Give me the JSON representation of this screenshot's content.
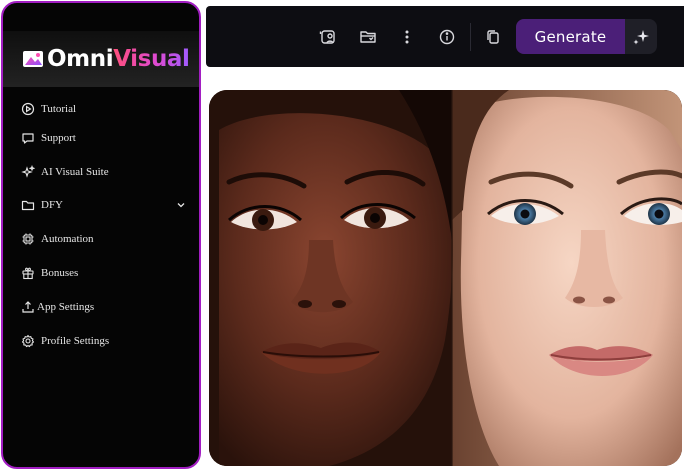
{
  "brand": {
    "name_part1": "Omni",
    "name_part2": "Visual",
    "icon": "omnivisual-logo-icon"
  },
  "sidebar": {
    "items": [
      {
        "label": "Tutorial",
        "icon": "play-circle-icon"
      },
      {
        "label": "Support",
        "icon": "chat-bubble-icon"
      },
      {
        "label": "AI Visual Suite",
        "icon": "sparkles-icon"
      },
      {
        "label": "DFY",
        "icon": "folder-icon",
        "expandable": true
      },
      {
        "label": "Automation",
        "icon": "chip-icon"
      },
      {
        "label": "Bonuses",
        "icon": "gift-icon"
      },
      {
        "label": "App Settings",
        "icon": "upload-icon"
      },
      {
        "label": "Profile Settings",
        "icon": "gear-icon"
      }
    ]
  },
  "toolbar": {
    "icons": [
      "image-user-icon",
      "folder-save-icon",
      "more-vertical-icon",
      "info-circle-icon",
      "copy-icon"
    ],
    "generate_label": "Generate",
    "generate_icon": "sparkle-magic-icon"
  },
  "preview": {
    "content": "generated-portrait-image"
  },
  "colors": {
    "accent": "#4b1f78",
    "sidebar_border": "#a21ec2",
    "toolbar_bg": "#0d0d12",
    "sidebar_bg": "#050505"
  }
}
